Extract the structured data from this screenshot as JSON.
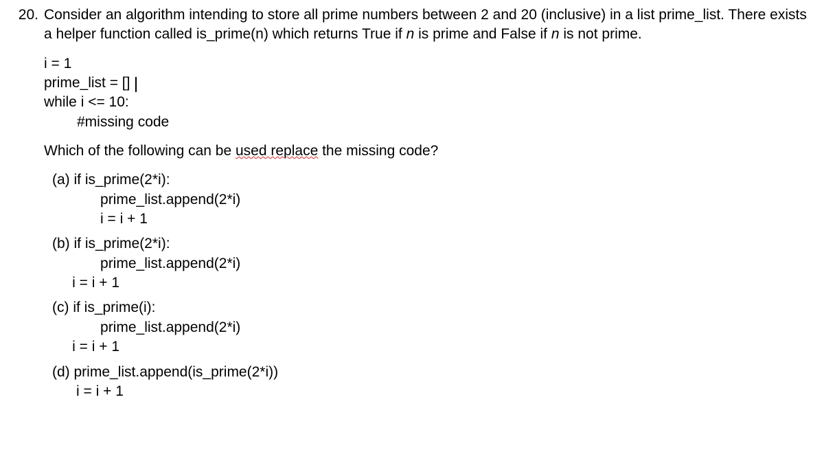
{
  "question": {
    "number": "20.",
    "stem_part1": "Consider an algorithm intending to store all prime numbers between 2 and 20 (inclusive) in a list prime_list. There exists a helper function called is_prime(n) which returns True if ",
    "stem_italic1": "n",
    "stem_part2": " is prime and False if ",
    "stem_italic2": "n",
    "stem_part3": " is not prime.",
    "code": {
      "l1": "i = 1",
      "l2a": "prime_list = [] ",
      "l3": "while i <= 10:",
      "l4": "#missing code"
    },
    "prompt_before": "Which of the following can be ",
    "prompt_wavy": "used replace",
    "prompt_after": " the missing code?",
    "options": {
      "a": {
        "label": "(a) if is_prime(2*i):",
        "line2": "            prime_list.append(2*i)",
        "line3": "            i = i + 1"
      },
      "b": {
        "label": "(b) if is_prime(2*i):",
        "line2": "            prime_list.append(2*i)",
        "line3": "     i = i + 1"
      },
      "c": {
        "label": "(c) if is_prime(i):",
        "line2": "            prime_list.append(2*i)",
        "line3": "     i = i + 1"
      },
      "d": {
        "label": "(d) prime_list.append(is_prime(2*i))",
        "line2": "      i = i + 1"
      }
    }
  }
}
